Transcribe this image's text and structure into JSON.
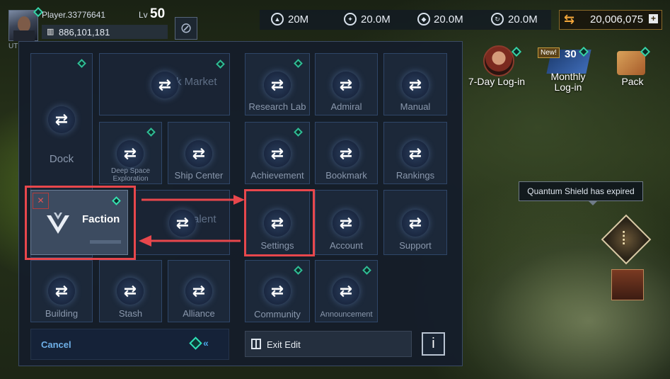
{
  "player": {
    "name": "Player.33776641",
    "level_label": "Lv",
    "level": "50",
    "power": "886,101,181",
    "alliance_tag": "UT"
  },
  "resources": [
    {
      "icon": "ore-icon",
      "value": "20M"
    },
    {
      "icon": "crystal-icon",
      "value": "20.0M"
    },
    {
      "icon": "gas-icon",
      "value": "20.0M"
    },
    {
      "icon": "energy-icon",
      "value": "20.0M"
    }
  ],
  "credits": {
    "value": "20,006,075",
    "plus": "+"
  },
  "events": {
    "seven_day": "7-Day Log-in",
    "monthly_line1": "Monthly",
    "monthly_line2": "Log-in",
    "monthly_badge": "New!",
    "monthly_number": "30",
    "pack": "Pack"
  },
  "shield_tooltip": "Quantum Shield has expired",
  "panel": {
    "tiles": {
      "dock": "Dock",
      "black_market": "k Market",
      "deep_space_line1": "Deep Space",
      "deep_space_line2": "Exploration",
      "ship_center": "Ship Center",
      "talent": "alent",
      "building": "Building",
      "stash": "Stash",
      "alliance": "Alliance",
      "research_lab": "Research Lab",
      "admiral": "Admiral",
      "manual": "Manual",
      "achievement": "Achievement",
      "bookmark": "Bookmark",
      "rankings": "Rankings",
      "settings": "Settings",
      "account": "Account",
      "support": "Support",
      "community": "Community",
      "announcement": "Announcement"
    },
    "faction": "Faction",
    "swap_symbol": "⇄",
    "cancel": "Cancel",
    "cancel_chevron": "«",
    "exit_edit": "Exit Edit",
    "info": "i"
  },
  "colors": {
    "highlight": "#e8474c",
    "accent_green": "#2fbd95",
    "credits_gold": "#f2a63a"
  }
}
